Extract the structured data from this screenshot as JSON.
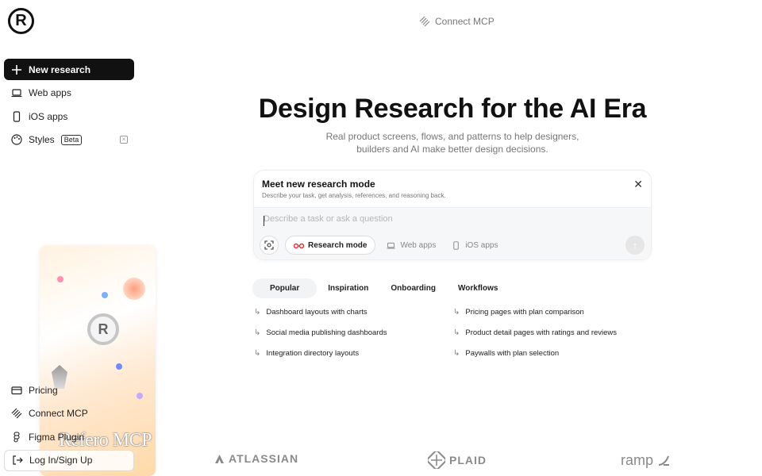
{
  "logo": {
    "glyph": "R"
  },
  "sidebar": {
    "items": [
      {
        "label": "New research",
        "icon": "plus-icon"
      },
      {
        "label": "Web apps",
        "icon": "laptop-icon"
      },
      {
        "label": "iOS apps",
        "icon": "phone-icon"
      },
      {
        "label": "Styles",
        "icon": "palette-icon",
        "badge": "Beta"
      }
    ],
    "bottom_items": [
      {
        "label": "Pricing",
        "icon": "card-icon"
      },
      {
        "label": "Connect MCP",
        "icon": "mcp-icon"
      },
      {
        "label": "Figma Plugin",
        "icon": "figma-icon"
      },
      {
        "label": "Log In/Sign Up",
        "icon": "login-icon"
      }
    ],
    "promo": {
      "logo_glyph": "R",
      "text": "Refero MCP"
    }
  },
  "top": {
    "connect_label": "Connect MCP"
  },
  "hero": {
    "title": "Design Research for the AI Era",
    "subtitle_line1": "Real product screens, flows, and patterns to help designers,",
    "subtitle_line2": "builders and AI make better design decisions."
  },
  "research_card": {
    "title": "Meet new research mode",
    "description": "Describe your task, get analysis, references, and reasoning back.",
    "placeholder": "Describe a task or ask a question",
    "mode_label": "Research mode",
    "chips": [
      "Web apps",
      "iOS apps"
    ]
  },
  "tabs": [
    "Popular",
    "Inspiration",
    "Onboarding",
    "Workflows"
  ],
  "suggestions_left": [
    "Dashboard layouts with charts",
    "Social media publishing dashboards",
    "Integration directory layouts"
  ],
  "suggestions_right": [
    "Pricing pages with plan comparison",
    "Product detail pages with ratings and reviews",
    "Paywalls with plan selection"
  ],
  "brands": [
    "ATLASSIAN",
    "PLAID",
    "ramp"
  ],
  "colors": {
    "primary": "#111111",
    "muted": "#777777",
    "input_bg": "#f6f7f9",
    "tab_active_bg": "#f2f3f5"
  }
}
